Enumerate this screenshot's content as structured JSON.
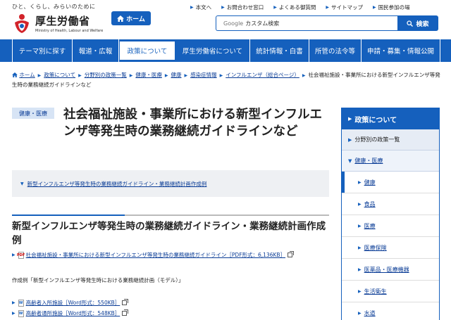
{
  "header": {
    "tagline": "ひと、くらし、みらいのために",
    "site_title": "厚生労働省",
    "site_title_en": "Ministry of Health, Labour and Welfare",
    "home_label": "ホーム",
    "util_links": [
      "本文へ",
      "お問合わせ窓口",
      "よくある御質問",
      "サイトマップ",
      "国民参加の場"
    ],
    "search_engine_label": "Google",
    "search_placeholder": "カスタム検索",
    "search_button": "検索"
  },
  "nav": {
    "items": [
      "テーマ別に探す",
      "報道・広報",
      "政策について",
      "厚生労働省について",
      "統計情報・白書",
      "所管の法令等",
      "申請・募集・情報公開"
    ],
    "active_index": 2
  },
  "breadcrumb": {
    "items": [
      "ホーム",
      "政策について",
      "分野別の政策一覧",
      "健康・医療",
      "健康",
      "感染症情報",
      "インフルエンザ（総合ページ）"
    ],
    "current": "社会福祉施設・事業所における新型インフルエンザ等発生時の業務継続ガイドラインなど"
  },
  "main": {
    "category_badge": "健康・医療",
    "title": "社会福祉施設・事業所における新型インフルエンザ等発生時の業務継続ガイドラインなど",
    "toc_link": "新型インフルエンザ等発生時の業務継続ガイドライン・業務継続計画作成例",
    "section_title": "新型インフルエンザ等発生時の業務継続ガイドライン・業務継続計画作成例",
    "pdf_link": "社会福祉施設・事業所における新型インフルエンザ等発生時の業務継続ガイドライン［PDF形式：6,136KB］",
    "example_text": "作成例「新型インフルエンザ等発生時における業務継続計画（モデル）」",
    "word_links": [
      "高齢者入所施設［Word形式：550KB］",
      "高齢者通所施設［Word形式：548KB］"
    ],
    "pdf_icon_label": "PDF",
    "word_icon_label": "W"
  },
  "sidebar": {
    "heading": "政策について",
    "sub_heading": "分野別の政策一覧",
    "category": "健康・医療",
    "items": [
      "健康",
      "食品",
      "医療",
      "医療保険",
      "医薬品・医療機器",
      "生活衛生",
      "水道"
    ],
    "current_index": 0
  },
  "colors": {
    "primary": "#1560bd",
    "link": "#0a3c96",
    "badge_bg": "#d7e4f5",
    "toc_bg": "#eef0f3"
  }
}
